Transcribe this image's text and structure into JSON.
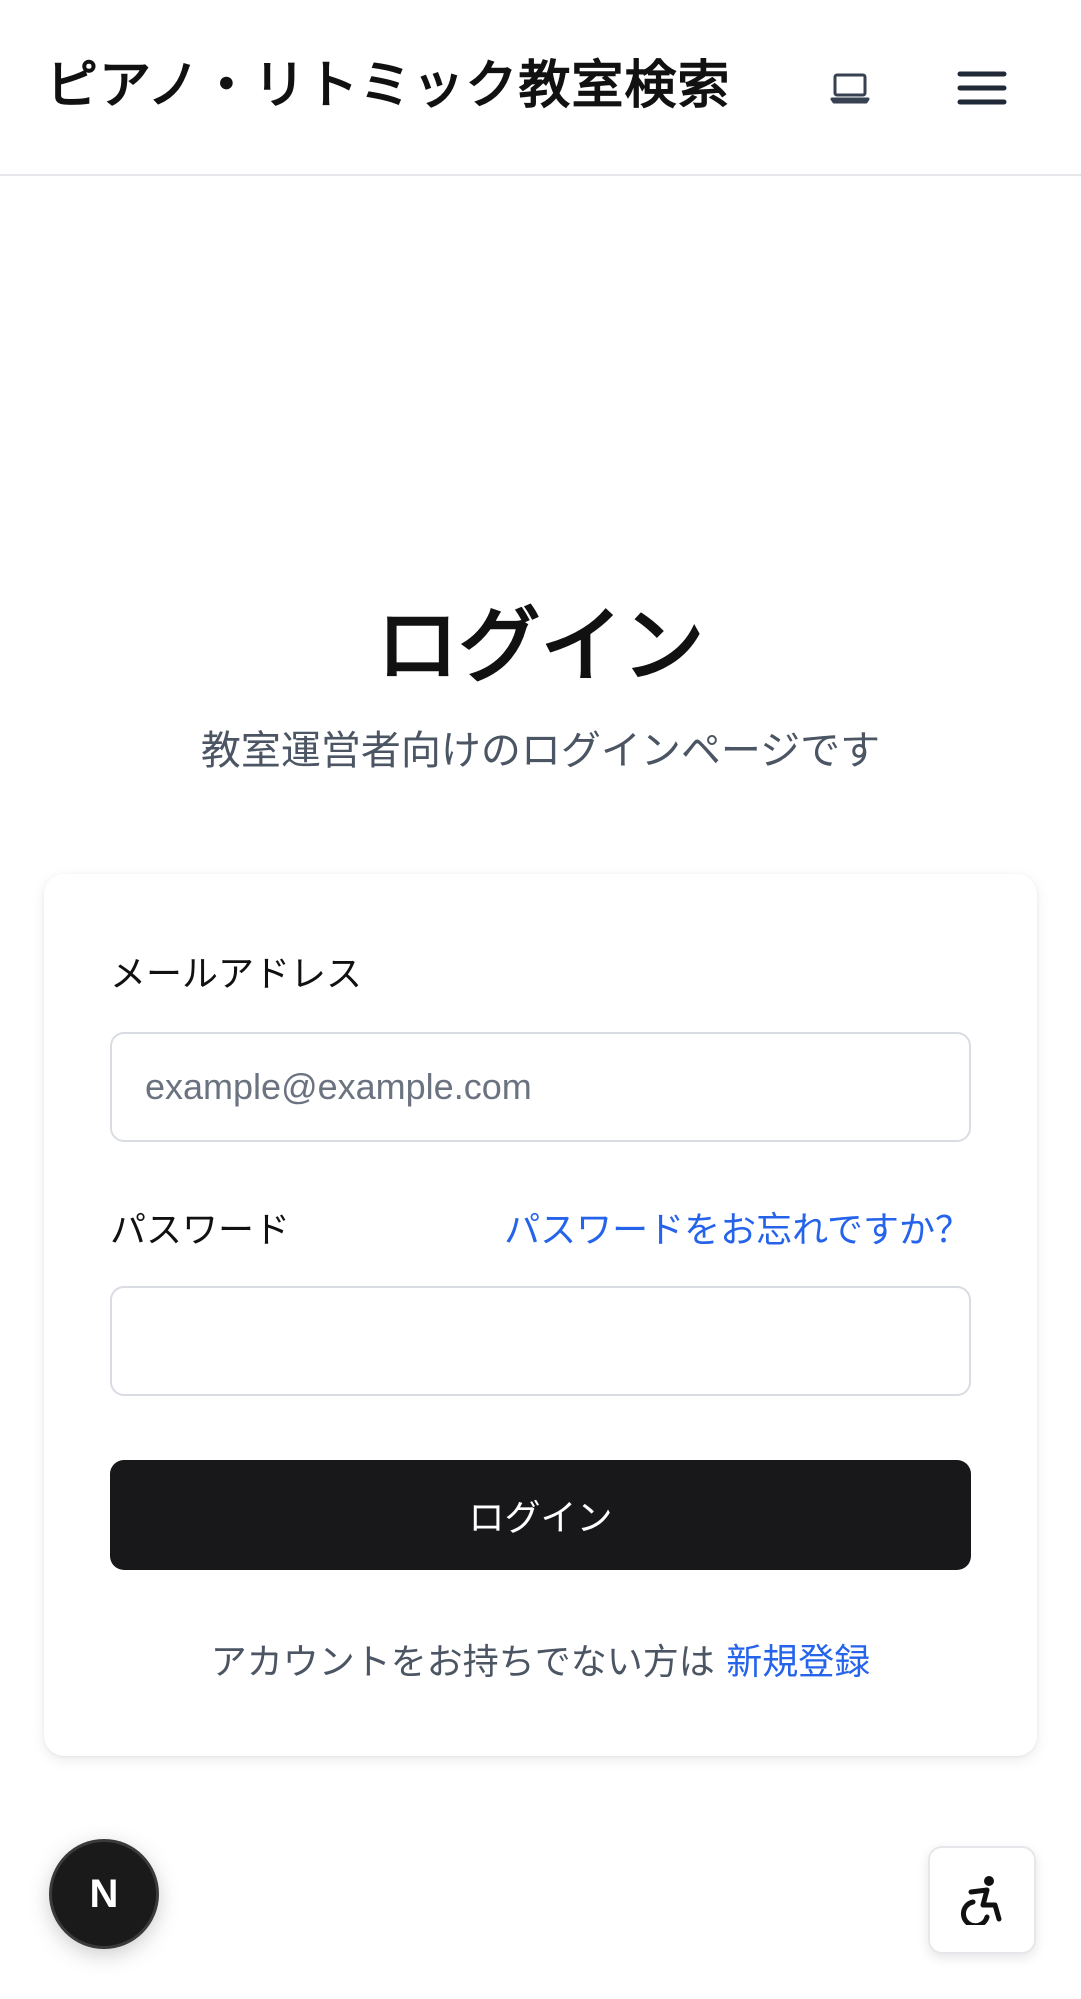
{
  "header": {
    "site_title": "ピアノ・リトミック教室検索",
    "laptop_icon": "laptop-icon",
    "menu_icon": "hamburger-menu-icon"
  },
  "main": {
    "heading": "ログイン",
    "subtitle": "教室運営者向けのログインページです"
  },
  "form": {
    "email_label": "メールアドレス",
    "email_placeholder": "example@example.com",
    "email_value": "",
    "password_label": "パスワード",
    "password_value": "",
    "forgot_link": "パスワードをお忘れですか？",
    "submit_label": "ログイン",
    "signup_prompt": "アカウントをお持ちでない方は",
    "signup_link": "新規登録"
  },
  "floating": {
    "next_badge_letter": "N",
    "accessibility_icon": "accessibility-icon"
  },
  "colors": {
    "accent_link": "#2563eb",
    "button_bg": "#18181b",
    "muted_text": "#4b5563"
  }
}
